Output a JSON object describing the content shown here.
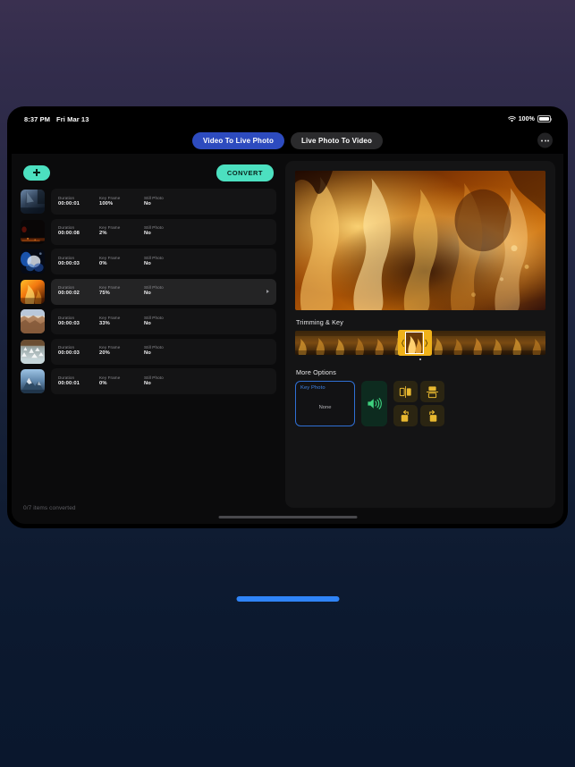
{
  "statusbar": {
    "time": "8:37 PM",
    "date": "Fri Mar 13",
    "battery_percent": "100%",
    "wifi_icon": "wifi-icon",
    "battery_icon": "battery-full-icon"
  },
  "navbar": {
    "tabs": [
      {
        "label": "Video To Live Photo",
        "active": true
      },
      {
        "label": "Live Photo To Video",
        "active": false
      }
    ],
    "more_icon": "ellipsis-icon"
  },
  "toolbar": {
    "add_icon": "plus-icon",
    "add_label": "",
    "convert_label": "CONVERT"
  },
  "list": {
    "columns": [
      "Duration",
      "Key Frame",
      "Still Photo"
    ],
    "items": [
      {
        "duration": "00:00:01",
        "key_frame": "100%",
        "still_photo": "No",
        "selected": false,
        "thumb": "ship-mast-blue"
      },
      {
        "duration": "00:00:08",
        "key_frame": "2%",
        "still_photo": "No",
        "selected": false,
        "thumb": "dark-embers"
      },
      {
        "duration": "00:00:03",
        "key_frame": "0%",
        "still_photo": "No",
        "selected": false,
        "thumb": "blue-smoke"
      },
      {
        "duration": "00:00:02",
        "key_frame": "75%",
        "still_photo": "No",
        "selected": true,
        "thumb": "orange-fire"
      },
      {
        "duration": "00:00:03",
        "key_frame": "33%",
        "still_photo": "No",
        "selected": false,
        "thumb": "canyon-sunrise"
      },
      {
        "duration": "00:00:03",
        "key_frame": "20%",
        "still_photo": "No",
        "selected": false,
        "thumb": "ice-crystals"
      },
      {
        "duration": "00:00:01",
        "key_frame": "0%",
        "still_photo": "No",
        "selected": false,
        "thumb": "snow-mountain"
      }
    ],
    "row_arrow_icon": "play-arrow-icon"
  },
  "status": {
    "text": "0/7 items converted"
  },
  "preview": {
    "media_name": "fire-flames-video-preview"
  },
  "trimming": {
    "title": "Trimming & Key",
    "selection_position_percent": 41,
    "selection_width_percent": 13.5
  },
  "more_options": {
    "title": "More Options",
    "key_photo": {
      "label": "Key Photo",
      "value": "None"
    },
    "sound_icon": "speaker-volume-icon",
    "tools": [
      {
        "icon": "flip-horizontal-icon"
      },
      {
        "icon": "flip-vertical-icon"
      },
      {
        "icon": "rotate-left-icon"
      },
      {
        "icon": "rotate-right-icon"
      }
    ]
  },
  "colors": {
    "accent_teal": "#4ce0c0",
    "tab_active_blue": "#2d4bbf",
    "key_photo_blue": "#3f85e8",
    "tool_yellow": "#e8b830",
    "sound_green": "#3fd17f",
    "page_bar_blue": "#2f84f7"
  }
}
